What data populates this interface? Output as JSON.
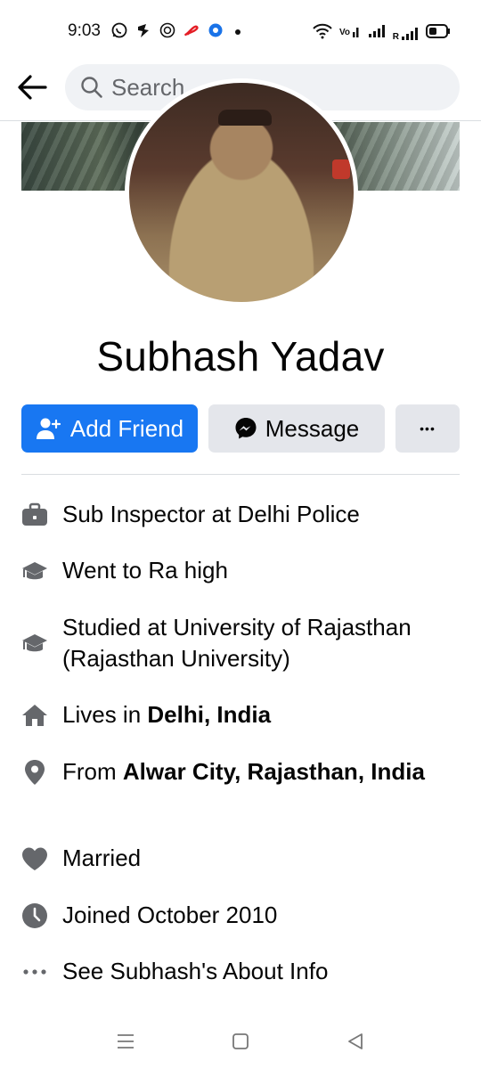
{
  "status_bar": {
    "time": "9:03",
    "left_icons": [
      "whatsapp-icon",
      "hike-icon",
      "cash-app-icon",
      "airtel-icon",
      "notification-app-icon"
    ],
    "right_icons": [
      "wifi-icon",
      "volte-signal-icon",
      "signal-icon",
      "roaming-signal-icon",
      "battery-icon"
    ],
    "roaming_label": "R"
  },
  "header": {
    "search_placeholder": "Search"
  },
  "profile": {
    "name": "Subhash Yadav"
  },
  "actions": {
    "add_friend_label": "Add Friend",
    "message_label": "Message",
    "more_label": "•••"
  },
  "info": {
    "work": "Sub Inspector at Delhi Police",
    "high_school": "Went to Ra high",
    "college": "Studied at University of Rajasthan (Rajasthan University)",
    "lives_prefix": "Lives in ",
    "lives_place": "Delhi, India",
    "from_prefix": "From ",
    "from_place": "Alwar City, Rajasthan, India",
    "relationship": "Married",
    "joined": "Joined October 2010",
    "about_link": "See Subhash's About Info"
  },
  "colors": {
    "accent": "#1877f2",
    "secondary_button": "#e4e6eb",
    "icon_gray": "#65676b",
    "search_bg": "#f0f2f5"
  }
}
